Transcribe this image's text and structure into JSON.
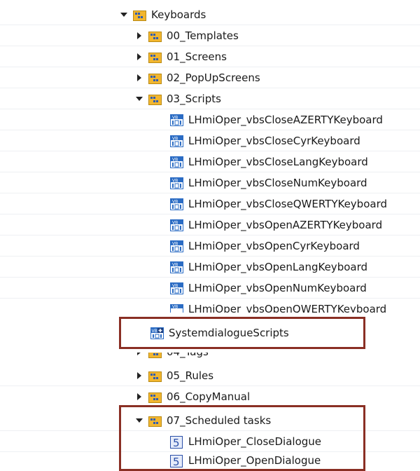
{
  "tree": {
    "root": {
      "label": "Keyboards",
      "icon": "folder-icon",
      "expanded": true
    },
    "folders": [
      {
        "label": "00_Templates",
        "icon": "folder-icon",
        "expanded": false
      },
      {
        "label": "01_Screens",
        "icon": "folder-icon",
        "expanded": false
      },
      {
        "label": "02_PopUpScreens",
        "icon": "folder-icon",
        "expanded": false
      },
      {
        "label": "03_Scripts",
        "icon": "folder-icon",
        "expanded": true
      }
    ],
    "scripts": [
      "LHmiOper_vbsCloseAZERTYKeyboard",
      "LHmiOper_vbsCloseCyrKeyboard",
      "LHmiOper_vbsCloseLangKeyboard",
      "LHmiOper_vbsCloseNumKeyboard",
      "LHmiOper_vbsCloseQWERTYKeyboard",
      "LHmiOper_vbsOpenAZERTYKeyboard",
      "LHmiOper_vbsOpenCyrKeyboard",
      "LHmiOper_vbsOpenLangKeyboard",
      "LHmiOper_vbsOpenNumKeyboard",
      "LHmiOper_vbsOpenQWERTYKeyboard"
    ],
    "dragged_item": {
      "label": "SystemdialogueScripts",
      "icon": "vb-script-module-icon"
    },
    "more_folders": [
      {
        "label": "04_Tags",
        "icon": "folder-icon",
        "expanded": false
      },
      {
        "label": "05_Rules",
        "icon": "folder-icon",
        "expanded": false
      },
      {
        "label": "06_CopyManual",
        "icon": "folder-icon",
        "expanded": false
      }
    ],
    "scheduled": {
      "folder": {
        "label": "07_Scheduled tasks",
        "icon": "folder-icon",
        "expanded": true
      },
      "tasks": [
        {
          "label": "LHmiOper_CloseDialogue",
          "icon": "scheduled-task-icon"
        },
        {
          "label": "LHmiOper_OpenDialogue",
          "icon": "scheduled-task-icon"
        }
      ]
    }
  },
  "colors": {
    "highlight_border": "#8a2f24",
    "folder_fill": "#f2b62f",
    "script_blue": "#2b6cc4",
    "task_blue": "#2a4fa8"
  }
}
